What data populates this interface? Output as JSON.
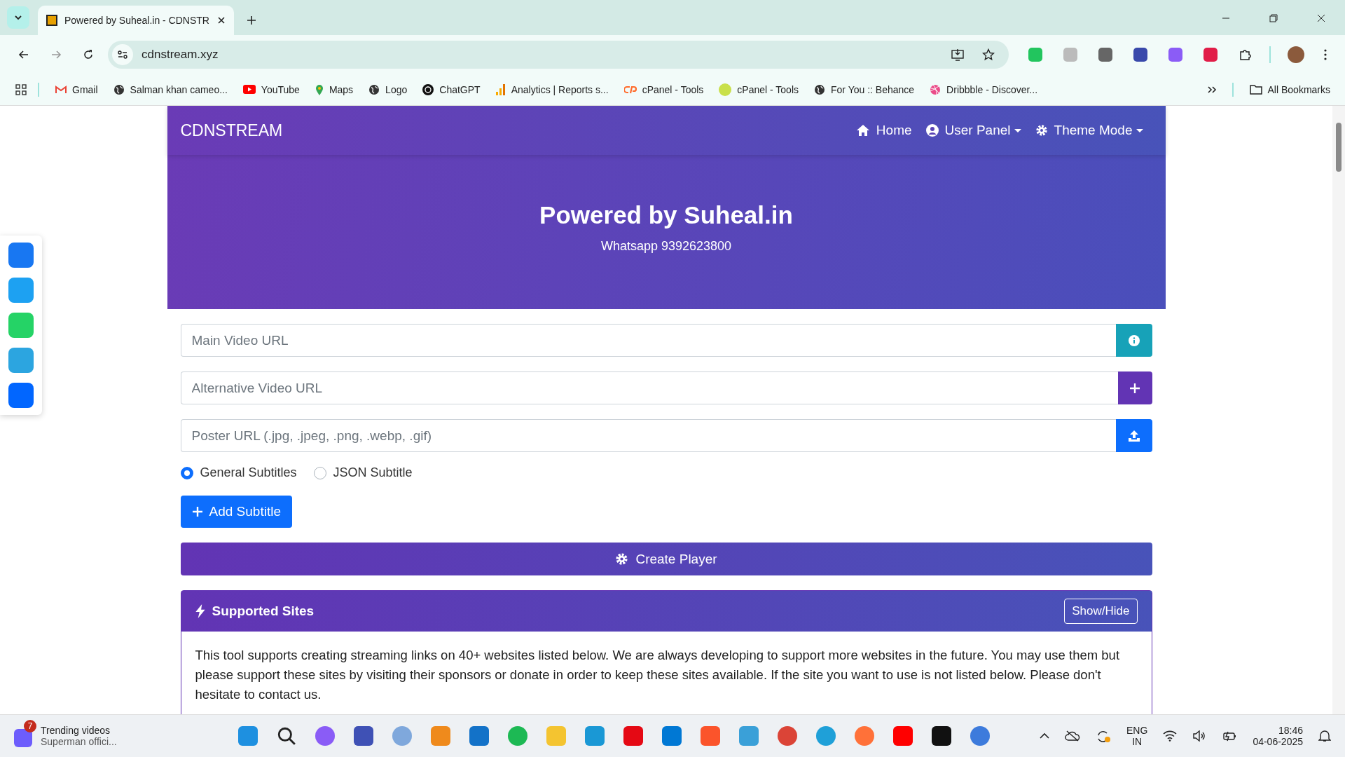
{
  "browser": {
    "tab_title": "Powered by Suheal.in - CDNSTR",
    "url": "cdnstream.xyz",
    "bookmarks": [
      {
        "label": "Gmail",
        "kind": "mail"
      },
      {
        "label": "Salman khan cameo...",
        "kind": "globe"
      },
      {
        "label": "YouTube",
        "kind": "play"
      },
      {
        "label": "Maps",
        "kind": "pin"
      },
      {
        "label": "Logo",
        "kind": "globe"
      },
      {
        "label": "ChatGPT",
        "kind": "knot"
      },
      {
        "label": "Analytics | Reports s...",
        "kind": "bars"
      },
      {
        "label": "cPanel - Tools",
        "kind": "cp"
      },
      {
        "label": "cPanel - Tools",
        "kind": "lime"
      },
      {
        "label": "For You :: Behance",
        "kind": "globe"
      },
      {
        "label": "Dribbble - Discover...",
        "kind": "ball"
      }
    ],
    "all_bookmarks": "All Bookmarks"
  },
  "navbar": {
    "brand": "CDNSTREAM",
    "items": [
      {
        "label": "Home",
        "kind": "home",
        "dropdown": false
      },
      {
        "label": "User Panel",
        "kind": "user",
        "dropdown": true
      },
      {
        "label": "Theme Mode",
        "kind": "gear",
        "dropdown": true
      }
    ]
  },
  "hero": {
    "title": "Powered by Suheal.in",
    "subtitle": "Whatsapp 9392623800"
  },
  "form": {
    "inputs": [
      {
        "placeholder": "Main Video URL",
        "kind": "info"
      },
      {
        "placeholder": "Alternative Video URL",
        "kind": "plus"
      },
      {
        "placeholder": "Poster URL (.jpg, .jpeg, .png, .webp, .gif)",
        "kind": "upload"
      }
    ],
    "subtitle_modes": [
      {
        "label": "General Subtitles",
        "selected": true
      },
      {
        "label": "JSON Subtitle",
        "selected": false
      }
    ],
    "add_subtitle": "Add Subtitle",
    "create_player": "Create Player"
  },
  "supported_sites": {
    "title": "Supported Sites",
    "toggle": "Show/Hide",
    "text": "This tool supports creating streaming links on 40+ websites listed below. We are always developing to support more websites in the future. You may use them but please support these sites by visiting their sponsors or donate in order to keep these sites available. If the site you want to use is not listed below. Please don't hesitate to contact us."
  },
  "taskbar": {
    "notification": {
      "count": "7",
      "title": "Trending videos",
      "subtitle": "Superman offici..."
    },
    "language": "ENG",
    "region": "IN",
    "time": "18:46",
    "date": "04-06-2025"
  }
}
